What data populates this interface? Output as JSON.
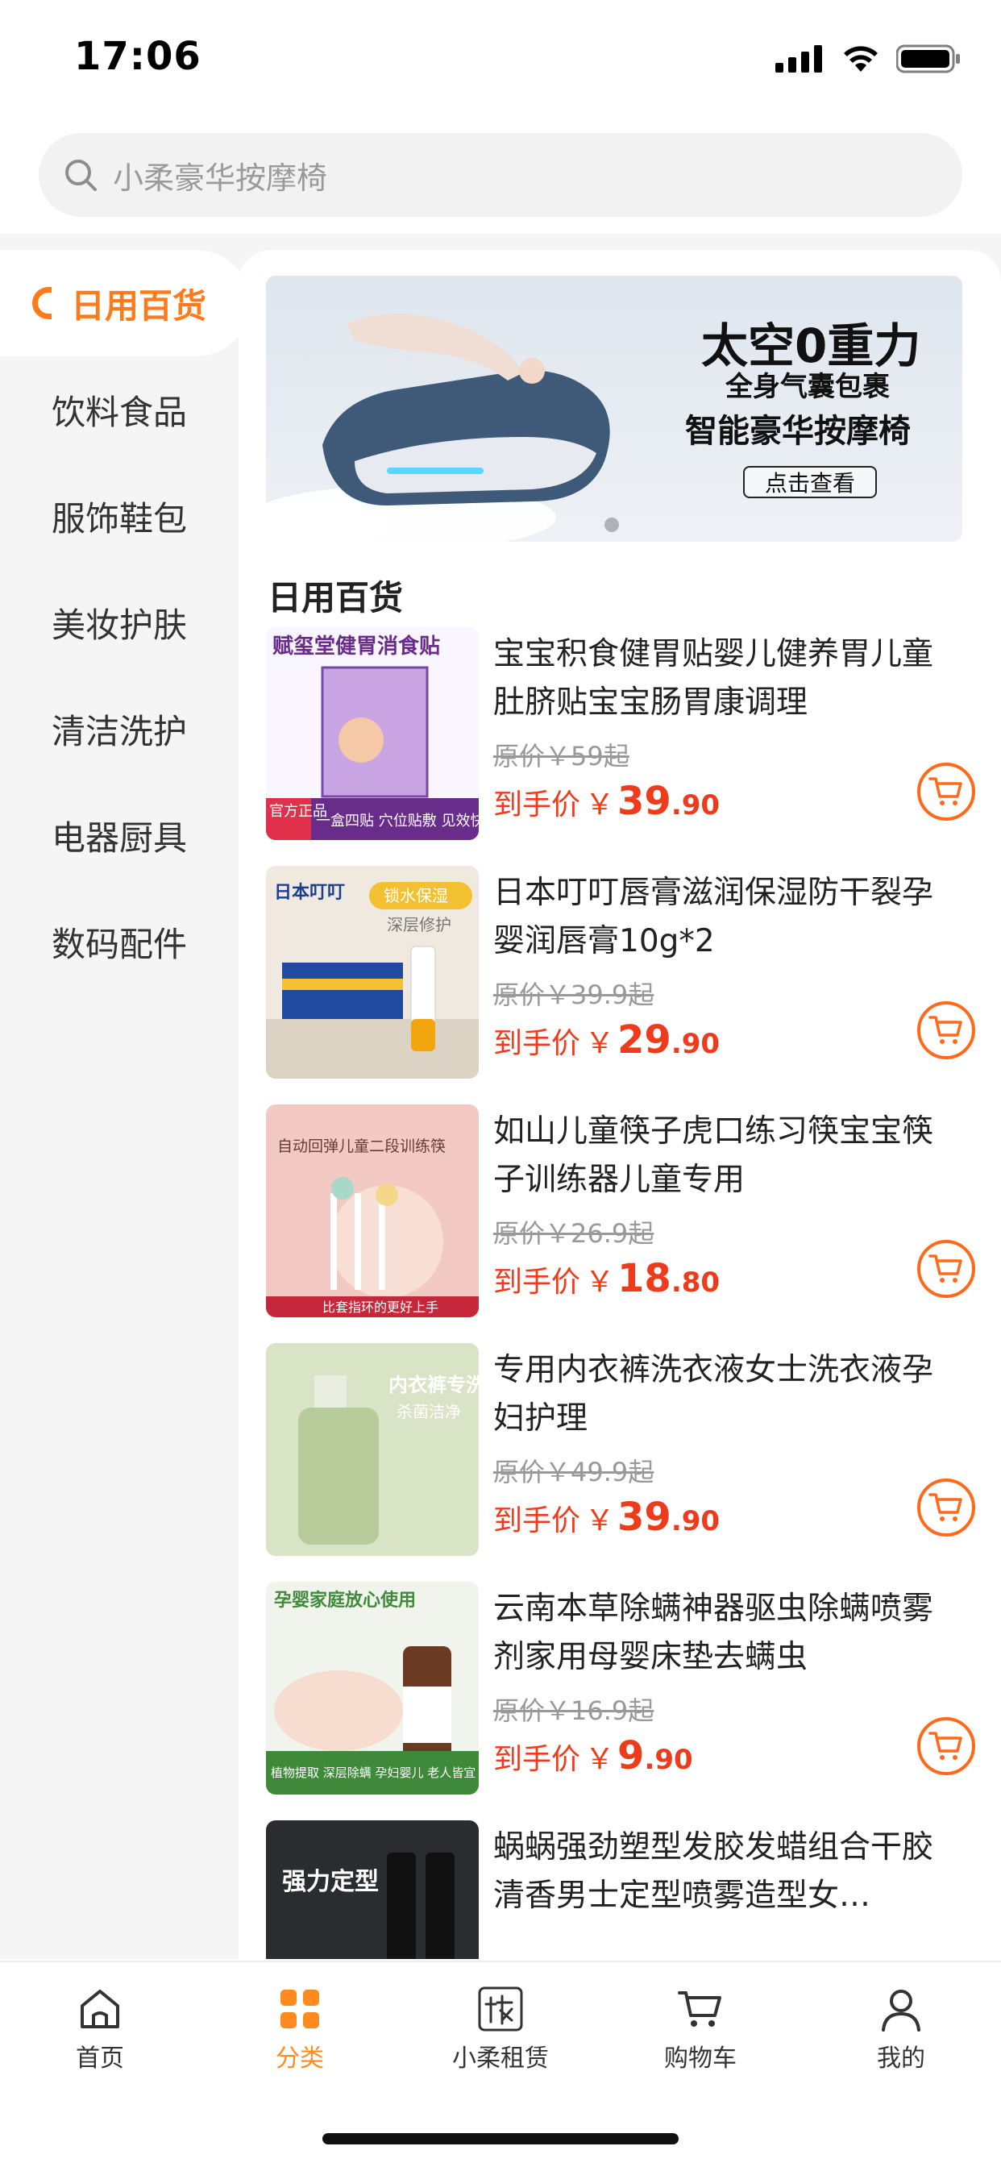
{
  "status_bar": {
    "time": "17:06"
  },
  "search": {
    "placeholder": "小柔豪华按摩椅"
  },
  "sidebar": {
    "items": [
      {
        "label": "日用百货",
        "active": true
      },
      {
        "label": "饮料食品"
      },
      {
        "label": "服饰鞋包"
      },
      {
        "label": "美妆护肤"
      },
      {
        "label": "清洁洗护"
      },
      {
        "label": "电器厨具"
      },
      {
        "label": "数码配件"
      }
    ]
  },
  "banner": {
    "line1": "太空0重力",
    "line2": "全身气囊包裹",
    "line3": "智能豪华按摩椅",
    "cta": "点击查看"
  },
  "section": {
    "title": "日用百货"
  },
  "products": [
    {
      "title": "宝宝积食健胃贴婴儿健养胃儿童肚脐贴宝宝肠胃康调理",
      "orig_price": "原价￥59起",
      "price_label": "到手价",
      "currency": "￥",
      "price_int": "39",
      "price_dec": ".90",
      "thumb_text": "赋玺堂健胃消食贴",
      "thumb_badge": "官方正品",
      "thumb_sub": "一盒四贴 穴位贴敷 见效快"
    },
    {
      "title": "日本叮叮唇膏滋润保湿防干裂孕婴润唇膏10g*2",
      "orig_price": "原价￥39.9起",
      "price_label": "到手价",
      "currency": "￥",
      "price_int": "29",
      "price_dec": ".90",
      "thumb_text": "日本叮叮",
      "thumb_badge": "锁水保湿",
      "thumb_sub": "深层修护"
    },
    {
      "title": "如山儿童筷子虎口练习筷宝宝筷子训练器儿童专用",
      "orig_price": "原价￥26.9起",
      "price_label": "到手价",
      "currency": "￥",
      "price_int": "18",
      "price_dec": ".80",
      "thumb_text": "自动回弹儿童二段训练筷",
      "thumb_badge": "",
      "thumb_sub": "比套指环的更好上手"
    },
    {
      "title": "专用内衣裤洗衣液女士洗衣液孕妇护理",
      "orig_price": "原价￥49.9起",
      "price_label": "到手价",
      "currency": "￥",
      "price_int": "39",
      "price_dec": ".90",
      "thumb_text": "内衣裤专洗原液",
      "thumb_badge": "",
      "thumb_sub": "杀菌洁净"
    },
    {
      "title": "云南本草除螨神器驱虫除螨喷雾剂家用母婴床垫去螨虫",
      "orig_price": "原价￥16.9起",
      "price_label": "到手价",
      "currency": "￥",
      "price_int": "9",
      "price_dec": ".90",
      "thumb_text": "孕婴家庭放心使用",
      "thumb_badge": "",
      "thumb_sub": "植物提取 深层除螨 孕妇婴儿 老人皆宜"
    },
    {
      "title": "蜗蜗强劲塑型发胶发蜡组合干胶清香男士定型喷雾造型女…",
      "orig_price": "",
      "price_label": "",
      "currency": "",
      "price_int": "",
      "price_dec": "",
      "thumb_text": "强力定型",
      "thumb_badge": "",
      "thumb_sub": ""
    }
  ],
  "tabbar": {
    "items": [
      {
        "label": "首页",
        "icon": "home-icon"
      },
      {
        "label": "分类",
        "icon": "category-icon",
        "active": true
      },
      {
        "label": "小柔租赁",
        "icon": "rental-icon"
      },
      {
        "label": "购物车",
        "icon": "cart-icon"
      },
      {
        "label": "我的",
        "icon": "profile-icon"
      }
    ]
  },
  "colors": {
    "accent": "#ff7a1a",
    "price": "#ee3b1c"
  }
}
